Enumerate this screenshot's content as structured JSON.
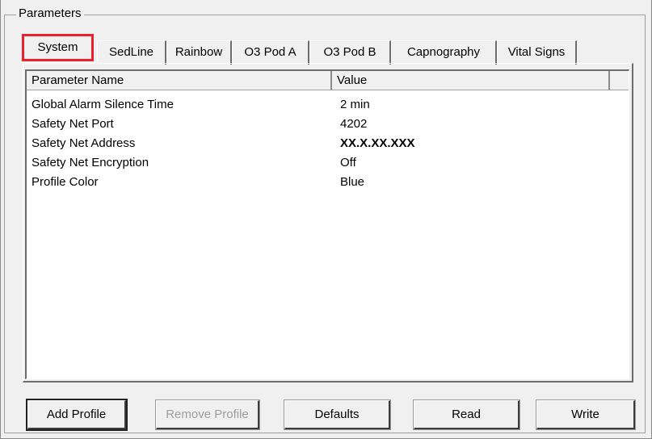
{
  "groupbox": {
    "title": "Parameters"
  },
  "tabs": [
    {
      "label": "System",
      "active": true
    },
    {
      "label": "SedLine",
      "active": false
    },
    {
      "label": "Rainbow",
      "active": false
    },
    {
      "label": "O3 Pod A",
      "active": false
    },
    {
      "label": "O3 Pod B",
      "active": false
    },
    {
      "label": "Capnography",
      "active": false
    },
    {
      "label": "Vital Signs",
      "active": false
    }
  ],
  "highlight_color": "#e8212b",
  "table": {
    "columns": [
      "Parameter Name",
      "Value"
    ],
    "rows": [
      {
        "name": "Global Alarm Silence Time",
        "value": "2 min"
      },
      {
        "name": "Safety Net Port",
        "value": "4202"
      },
      {
        "name": "Safety Net Address",
        "value": "XX.X.XX.XXX"
      },
      {
        "name": "Safety Net Encryption",
        "value": "Off"
      },
      {
        "name": "Profile Color",
        "value": "Blue"
      }
    ]
  },
  "buttons": {
    "add_profile": "Add Profile",
    "remove_profile": "Remove Profile",
    "defaults": "Defaults",
    "read": "Read",
    "write": "Write"
  }
}
